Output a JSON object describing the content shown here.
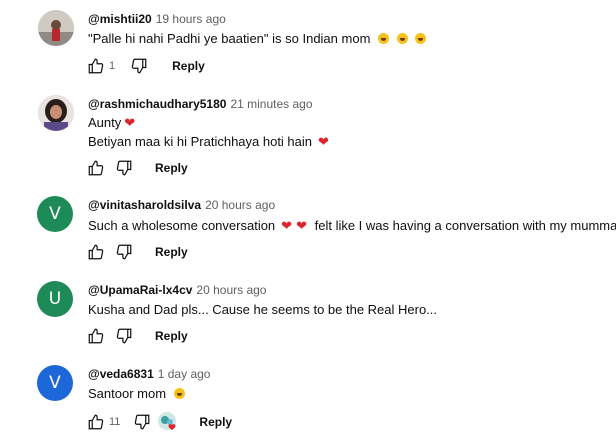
{
  "comments": [
    {
      "handle": "@mishtii20",
      "time": "19 hours ago",
      "text": "\"Palle hi nahi Padhi ye baatien\" is so Indian mom",
      "likes": "1",
      "reply_label": "Reply"
    },
    {
      "handle": "@rashmichaudhary5180",
      "time": "21 minutes ago",
      "text_line1": "Aunty",
      "text_line2": "Betiyan maa ki hi Pratichhaya hoti hain",
      "reply_label": "Reply"
    },
    {
      "avatar_letter": "V",
      "handle": "@vinitasharoldsilva",
      "time": "20 hours ago",
      "text_part1": "Such a wholesome conversation",
      "text_part2": "felt like I was having a conversation with my mumma.",
      "reply_label": "Reply"
    },
    {
      "avatar_letter": "U",
      "handle": "@UpamaRai-lx4cv",
      "time": "20 hours ago",
      "text": "Kusha and Dad pls... Cause he seems to be the Real Hero...",
      "reply_label": "Reply"
    },
    {
      "avatar_letter": "V",
      "handle": "@veda6831",
      "time": "1 day ago",
      "text": "Santoor mom",
      "likes": "11",
      "reply_label": "Reply"
    }
  ],
  "colors": {
    "avatar_green": "#1e8a57",
    "avatar_blue": "#1e67d8",
    "heart": "#e0242b",
    "meta_gray": "#606060"
  },
  "icons": [
    "thumbs-up-icon",
    "thumbs-down-icon",
    "heart-icon",
    "laughing-emoji-icon",
    "creator-heart-icon"
  ]
}
